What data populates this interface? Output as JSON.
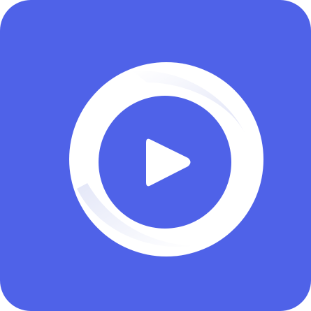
{
  "icon": {
    "name": "video-player-app-icon",
    "glyph": "play-icon",
    "colors": {
      "background": "#4F62E8",
      "ring": "#FFFFFF",
      "ring_shade": "#D9DDF5",
      "play": "#FFFFFF"
    }
  }
}
